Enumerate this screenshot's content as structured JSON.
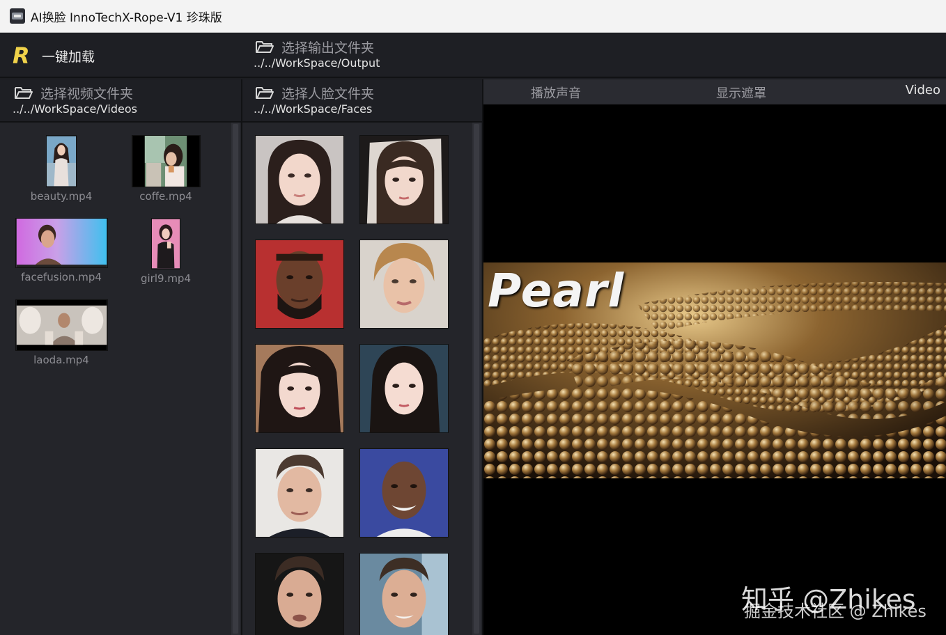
{
  "window": {
    "title": "AI换脸  InnoTechX-Rope-V1 珍珠版"
  },
  "toolbar": {
    "load_label": "一键加载",
    "output_folder_label": "选择输出文件夹",
    "output_folder_path": "../../WorkSpace/Output"
  },
  "videos": {
    "folder_label": "选择视频文件夹",
    "folder_path": "../../WorkSpace/Videos",
    "items": [
      {
        "name": "beauty.mp4"
      },
      {
        "name": "coffe.mp4"
      },
      {
        "name": "facefusion.mp4"
      },
      {
        "name": "girl9.mp4"
      },
      {
        "name": "laoda.mp4"
      }
    ]
  },
  "faces": {
    "folder_label": "选择人脸文件夹",
    "folder_path": "../../WorkSpace/Faces",
    "count": 10
  },
  "viewer": {
    "play_audio_label": "播放声音",
    "show_mask_label": "显示遮罩",
    "mode_label": "Video",
    "frame_text": "Pearl"
  },
  "watermark": {
    "line1": "知乎 @Zhikes",
    "line2": "掘金技术社区 @ Zhikes"
  },
  "colors": {
    "background": "#1c1d21",
    "panel": "#24252a",
    "accent": "#f0d24a",
    "muted_text": "#9a9aa0"
  }
}
